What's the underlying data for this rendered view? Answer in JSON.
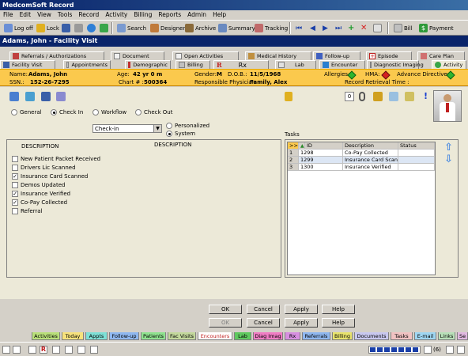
{
  "app": {
    "title": "MedcomSoft Record"
  },
  "menu": [
    "File",
    "Edit",
    "View",
    "Tools",
    "Record",
    "Activity",
    "Billing",
    "Reports",
    "Admin",
    "Help"
  ],
  "toolbar": {
    "logoff": "Log off",
    "lock": "Lock",
    "search": "Search",
    "designer": "Designer",
    "archive": "Archive",
    "summary": "Summary",
    "tracking": "Tracking",
    "bill": "Bill",
    "payment": "Payment"
  },
  "patient_header": "Adams, John - Facility Visit",
  "tabs_row1": [
    "Referrals / Authorizations",
    "Document",
    "Open Activities",
    "Medical History",
    "Follow-up",
    "Episode",
    "Care Plan"
  ],
  "tabs_row2": [
    "Facility Visit",
    "Appointments",
    "Demographic",
    "Billing",
    "Rx",
    "Lab",
    "Encounter",
    "Diagnostic Imaging",
    "Activity"
  ],
  "info": {
    "name_label": "Name:",
    "name": "Adams, John",
    "age_label": "Age:",
    "age": "42 yr 0 m",
    "gender_label": "Gender:",
    "gender": "M",
    "dob_label": "D.O.B.:",
    "dob": "11/5/1968",
    "allergies_label": "Allergies:",
    "hma_label": "HMA:",
    "advdir_label": "Advance Directives:",
    "ssn_label": "SSN.:",
    "ssn": "152-26-7295",
    "chart_label": "Chart # :",
    "chart": "500364",
    "physician_label": "Responsible Physician :",
    "physician": "Family, Alex",
    "retrieval_label": "Record Retrieval Time :"
  },
  "top_tools": {
    "counter": "0"
  },
  "mode_radios": {
    "general": "General",
    "checkin": "Check In",
    "workflow": "Workflow",
    "checkout": "Check Out"
  },
  "checkin_select": {
    "value": "Check-in"
  },
  "list_type": {
    "personalized": "Personalized",
    "system": "System"
  },
  "checklist": {
    "header": "DESCRIPTION",
    "header2": "DESCRIPTION",
    "items": [
      {
        "label": "New Patient Packet Received",
        "checked": false
      },
      {
        "label": "Drivers Lic Scanned",
        "checked": false
      },
      {
        "label": "Insurance Card Scanned",
        "checked": true
      },
      {
        "label": "Demos Updated",
        "checked": false
      },
      {
        "label": "Insurance Verified",
        "checked": true
      },
      {
        "label": "Co-Pay Collected",
        "checked": true
      },
      {
        "label": "Referral",
        "checked": false
      }
    ]
  },
  "tasks": {
    "title": "Tasks",
    "columns": [
      ">>",
      "ID",
      "Description",
      "Status"
    ],
    "rows": [
      {
        "num": "1",
        "id": "1298",
        "description": "Co-Pay Collected",
        "status": ""
      },
      {
        "num": "2",
        "id": "1299",
        "description": "Insurance Card Scan...",
        "status": ""
      },
      {
        "num": "3",
        "id": "1300",
        "description": "Insurance Verified",
        "status": ""
      }
    ]
  },
  "buttons": {
    "ok": "OK",
    "cancel": "Cancel",
    "apply": "Apply",
    "help": "Help"
  },
  "bottom_tabs": [
    {
      "label": "Activities",
      "color": "#b9e07a"
    },
    {
      "label": "Today",
      "color": "#f7e27c"
    },
    {
      "label": "Appts",
      "color": "#7ee0d6"
    },
    {
      "label": "Follow-up",
      "color": "#8fb7ef"
    },
    {
      "label": "Patients",
      "color": "#8fe28f"
    },
    {
      "label": "Fac Visits",
      "color": "#c3d89c"
    },
    {
      "label": "Encounters",
      "color": "#ffffff"
    },
    {
      "label": "Lab",
      "color": "#5fc95f"
    },
    {
      "label": "Diag Imag",
      "color": "#f07dc4"
    },
    {
      "label": "Rx",
      "color": "#d78fe0"
    },
    {
      "label": "Referrals",
      "color": "#8fb7ef"
    },
    {
      "label": "Billing",
      "color": "#e8e36d"
    },
    {
      "label": "Documents",
      "color": "#c8c8ef"
    },
    {
      "label": "Tasks",
      "color": "#f0c2c2"
    },
    {
      "label": "E-mail",
      "color": "#9fd6f2"
    },
    {
      "label": "Links",
      "color": "#b8e0b8"
    },
    {
      "label": "Se",
      "color": "#e0b8e0"
    }
  ],
  "status": {
    "count": "(6)"
  },
  "colors": {
    "titlebar": "#0a246a",
    "patient_bar": "#0a246a",
    "info_bar": "#fbc94d",
    "allergy": "#2fb52f",
    "hma": "#d62020",
    "advdir": "#2fb52f"
  }
}
